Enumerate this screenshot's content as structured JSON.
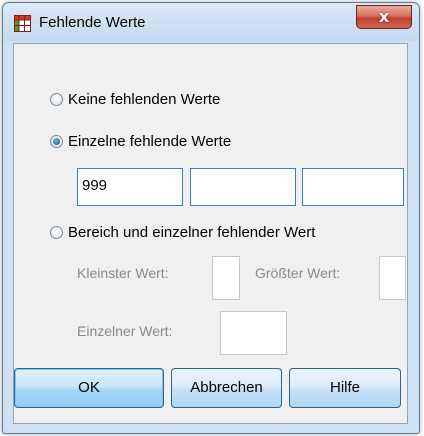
{
  "window": {
    "title": "Fehlende Werte",
    "close_glyph": "x"
  },
  "options": {
    "none_label": "Keine fehlenden Werte",
    "discrete_label": "Einzelne fehlende Werte",
    "range_label": "Bereich und einzelner fehlender Wert",
    "selected": "discrete"
  },
  "discrete_values": [
    "999",
    "",
    ""
  ],
  "range": {
    "low_label": "Kleinster Wert:",
    "low_value": "",
    "high_label": "Größter Wert:",
    "high_value": "",
    "discrete_label": "Einzelner Wert:",
    "discrete_value": ""
  },
  "buttons": {
    "ok": "OK",
    "cancel": "Abbrechen",
    "help": "Hilfe"
  },
  "colors": {
    "accent_border": "#3a7bd5",
    "close_red": "#c2412c",
    "icon_red": "#d23a2a",
    "icon_green": "#3fa13a"
  }
}
